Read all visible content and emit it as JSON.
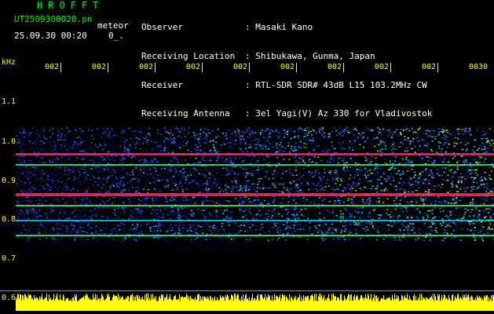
{
  "header": {
    "logo_text": "HROFFT",
    "file_name": "UT2509300020.pn",
    "mode_label": "meteor",
    "datetime": "25.09.30 00:20",
    "digit_readout": "0_."
  },
  "info": {
    "observer_label": "Observer",
    "observer_value": "Masaki Kano",
    "location_label": "Receiving Location",
    "location_value": "Shibukawa, Gunma, Japan",
    "receiver_label": "Receiver",
    "receiver_value": "RTL-SDR SDR# 43dB L15 103.2MHz CW",
    "antenna_label": "Receiving Antenna",
    "antenna_value": "3el Yagi(V) Az 330 for Vladivostok"
  },
  "axis": {
    "unit": "kHz",
    "y_labels": [
      "1.1",
      "1.0",
      "0.9",
      "0.8",
      "0.7",
      "0.6"
    ],
    "time_ticks": [
      "002",
      "002",
      "002",
      "002",
      "002",
      "002",
      "002",
      "002",
      "002",
      "0030"
    ]
  },
  "colors": {
    "background": "#000000",
    "header_text": "#ffffff",
    "axis_text": "#ffff00",
    "logo_text": "#00ff00",
    "amplitude_bar": "#ffff00",
    "signal_strong": "#ff3366"
  }
}
